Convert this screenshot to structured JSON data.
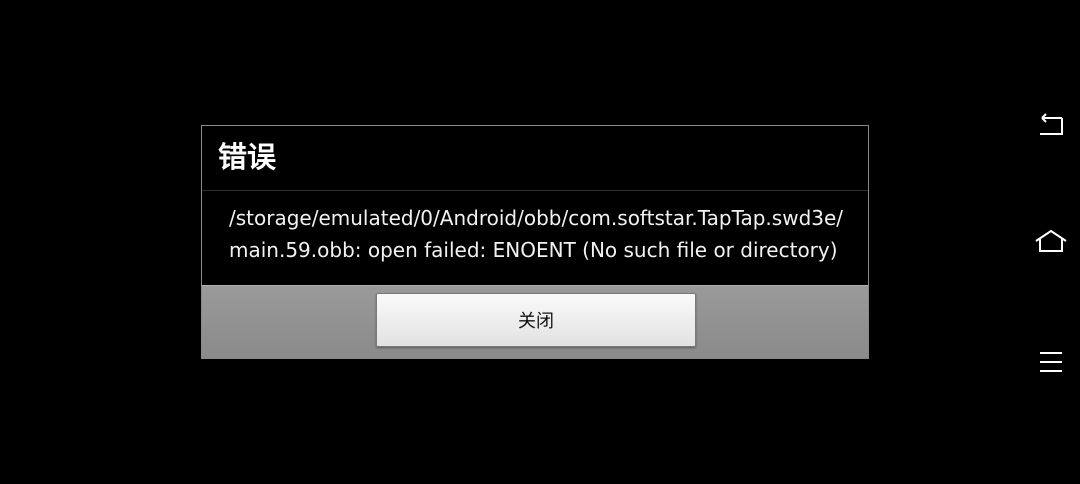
{
  "background_dialog": {
    "title": "错误"
  },
  "dialog": {
    "title": "错误",
    "message_lines": [
      "/storage/emulated/0/Android/obb/com.softstar.TapTap.swd3e/",
      "main.59.obb: open failed: ENOENT (No such file or directory)"
    ],
    "close_label": "关闭"
  },
  "nav_bar": {
    "buttons": [
      {
        "icon": "back-icon"
      },
      {
        "icon": "home-icon"
      },
      {
        "icon": "menu-icon"
      }
    ]
  },
  "colors": {
    "background": "#000000",
    "dialog_border": "#8a8a8a",
    "footer": "#8f8f8f",
    "button": "#eeeeee",
    "text": "#ffffff"
  }
}
